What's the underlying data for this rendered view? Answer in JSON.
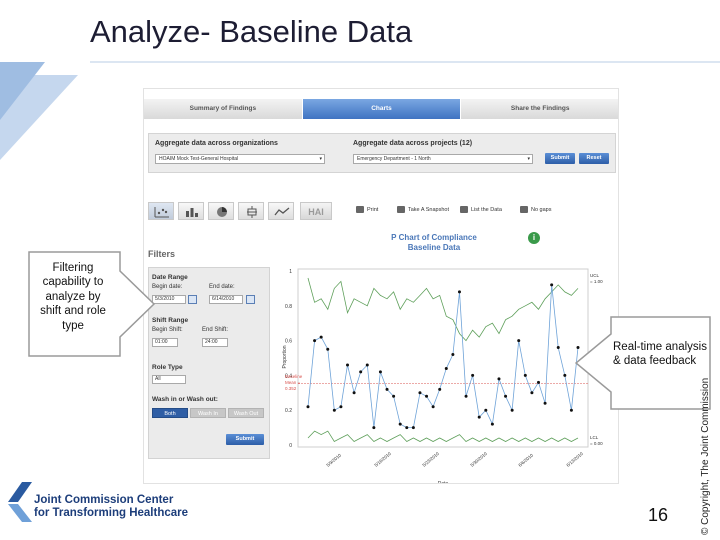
{
  "slide": {
    "title": "Analyze- Baseline Data",
    "page_number": "16",
    "copyright": "© Copyright, The Joint Commission",
    "logo_line1": "Joint Commission Center",
    "logo_line2": "for Transforming Healthcare",
    "callout_left": "Filtering capability to analyze by shift and role type",
    "callout_right": "Real-time analysis & data feedback",
    "colors": {
      "title": "#1d1d33",
      "accent_blue": "#2f5ea5",
      "deco_light": "#dbe6f4",
      "deco_mid": "#b9cde6"
    }
  },
  "screenshot": {
    "tabs": [
      {
        "label": "Summary of Findings",
        "active": false
      },
      {
        "label": "Charts",
        "active": true
      },
      {
        "label": "Share the Findings",
        "active": false
      }
    ],
    "aggregate": {
      "orgs_label": "Aggregate data across organizations",
      "orgs_value": "HOAIM Mock Test-General Hospital",
      "projects_label": "Aggregate data across projects (12)",
      "projects_value": "Emergency Department - 1 North",
      "submit_label": "Submit",
      "reset_label": "Reset"
    },
    "toolbar": {
      "icons": [
        "scatter-chart-icon",
        "bar-chart-icon",
        "pie-chart-icon",
        "box-plot-icon",
        "line-chart-icon"
      ],
      "hai_label": "HAI",
      "print_label": "Print",
      "snapshot_label": "Take A Snapshot",
      "list_label": "List the Data",
      "gaps_label": "No gaps"
    },
    "filters": {
      "title": "Filters",
      "date_range_label": "Date Range",
      "begin_date_label": "Begin date:",
      "begin_date_value": "5/3/2010",
      "end_date_label": "End date:",
      "end_date_value": "6/14/2010",
      "shift_range_label": "Shift Range",
      "begin_shift_label": "Begin Shift:",
      "begin_shift_value": "01:00",
      "end_shift_label": "End Shift:",
      "end_shift_value": "24:00",
      "role_type_label": "Role Type",
      "role_type_value": "All",
      "wash_label": "Wash in or Wash out:",
      "wash_options": [
        "Both",
        "Wash In",
        "Wash Out"
      ],
      "wash_selected": "Both",
      "submit_label": "Submit"
    },
    "chart": {
      "title_line1": "P Chart of Compliance",
      "title_line2": "Baseline Data",
      "info_label": "i"
    }
  },
  "chart_data": {
    "type": "line",
    "title": "P Chart of Compliance Baseline Data",
    "xlabel": "Date",
    "ylabel": "Proportion",
    "ylim": [
      0,
      1
    ],
    "y_ticks": [
      "0",
      "0.2",
      "0.4",
      "0.6",
      "0.8",
      "1"
    ],
    "x_ticks": [
      "5/9/2010",
      "5/16/2010",
      "5/23/2010",
      "5/30/2010",
      "6/6/2010",
      "6/13/2010"
    ],
    "annotations": {
      "ucl": "UCL = 1.00",
      "lcl": "LCL = 0.00",
      "baseline": "Baseline Mean = 0.352"
    },
    "series": [
      {
        "name": "Proportion",
        "color": "#6fa3d8",
        "point_color": "#111111",
        "values": [
          0.22,
          0.6,
          0.62,
          0.55,
          0.2,
          0.22,
          0.46,
          0.3,
          0.42,
          0.46,
          0.1,
          0.42,
          0.32,
          0.28,
          0.12,
          0.1,
          0.1,
          0.3,
          0.28,
          0.22,
          0.32,
          0.44,
          0.52,
          0.88,
          0.28,
          0.4,
          0.16,
          0.2,
          0.12,
          0.38,
          0.28,
          0.2,
          0.6,
          0.4,
          0.3,
          0.36,
          0.24,
          0.92,
          0.56,
          0.4,
          0.2,
          0.56
        ]
      },
      {
        "name": "UCL",
        "color": "#5e9f5a",
        "values": [
          0.96,
          0.82,
          0.84,
          0.78,
          0.9,
          0.94,
          0.76,
          0.84,
          0.82,
          0.8,
          0.9,
          0.86,
          0.84,
          0.88,
          0.78,
          0.84,
          0.82,
          0.86,
          0.9,
          0.84,
          0.86,
          0.74,
          0.72,
          0.64,
          0.6,
          0.66,
          0.62,
          0.68,
          0.7,
          0.64,
          0.72,
          0.74,
          0.78,
          0.8,
          0.82,
          0.78,
          0.84,
          0.88,
          0.92,
          0.88,
          0.86,
          0.9
        ]
      },
      {
        "name": "LCL",
        "color": "#5e9f5a",
        "values": [
          0.04,
          0.08,
          0.06,
          0.08,
          0.02,
          0.04,
          0.06,
          0.02,
          0.04,
          0.06,
          0.02,
          0.04,
          0.02,
          0.04,
          0.06,
          0.02,
          0.04,
          0.02,
          0.04,
          0.02,
          0.04,
          0.02,
          0.04,
          0.06,
          0.02,
          0.04,
          0.02,
          0.04,
          0.02,
          0.04,
          0.02,
          0.04,
          0.02,
          0.04,
          0.02,
          0.04,
          0.02,
          0.04,
          0.02,
          0.04,
          0.02,
          0.04
        ]
      },
      {
        "name": "Baseline Mean",
        "color": "#d9534f",
        "values_constant": 0.352
      }
    ],
    "grid": false,
    "legend": "none"
  }
}
